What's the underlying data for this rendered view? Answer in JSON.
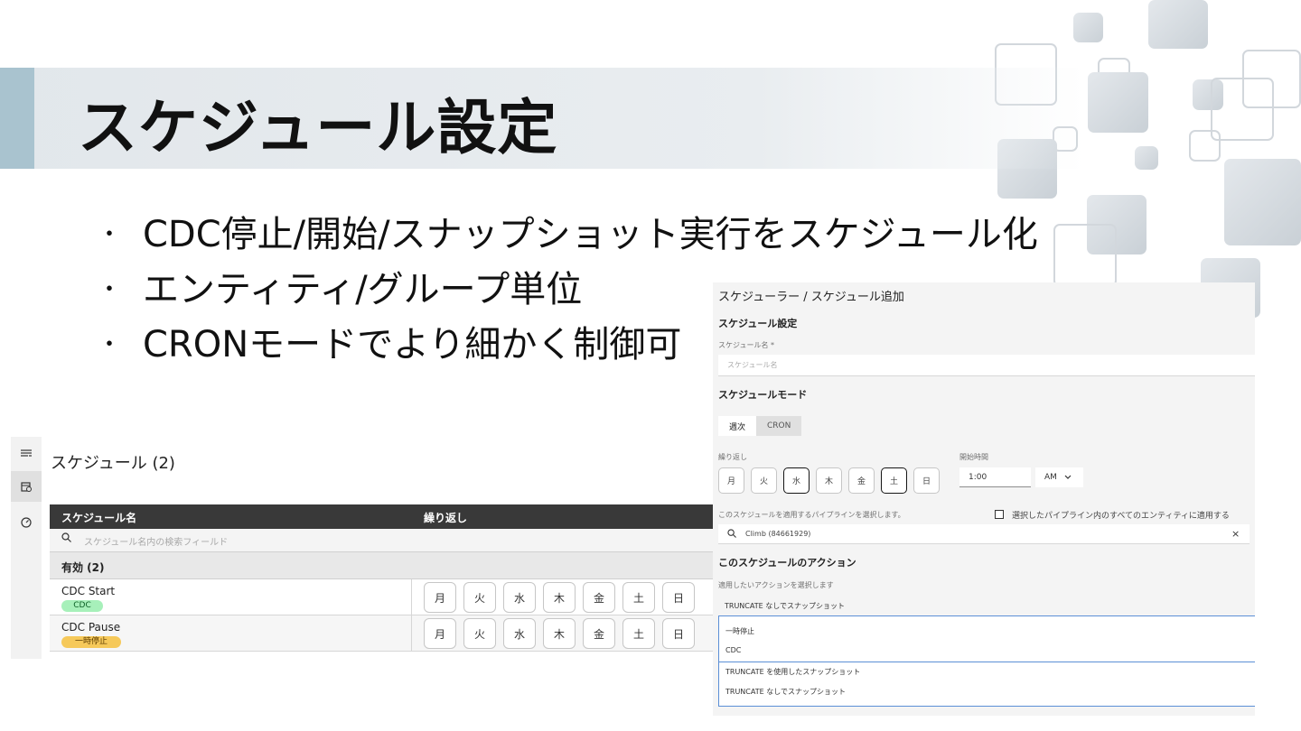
{
  "slide": {
    "title": "スケジュール設定",
    "bullet_marker": "・",
    "bullets": [
      "CDC停止/開始/スナップショット実行をスケジュール化",
      "エンティティ/グループ単位",
      "CRONモードでより細かく制御可"
    ]
  },
  "schedule_list": {
    "rail_icons": [
      "list-icon",
      "calendar-icon",
      "dashboard-icon"
    ],
    "title": "スケジュール (2)",
    "columns": [
      "スケジュール名",
      "繰り返し"
    ],
    "search_placeholder": "スケジュール名内の検索フィールド",
    "group_label": "有効 (2)",
    "days": [
      "月",
      "火",
      "水",
      "木",
      "金",
      "土",
      "日"
    ],
    "rows": [
      {
        "name": "CDC Start",
        "badge": "CDC",
        "badge_color": "#a7f0ba"
      },
      {
        "name": "CDC Pause",
        "badge": "一時停止",
        "badge_color": "#f6c95a"
      }
    ]
  },
  "add_form": {
    "breadcrumb": "スケジューラー / スケジュール追加",
    "section_settings": "スケジュール設定",
    "name_label": "スケジュール名 *",
    "name_placeholder": "スケジュール名",
    "section_mode": "スケジュールモード",
    "tabs": [
      "週次",
      "CRON"
    ],
    "active_tab": "週次",
    "repeat_label": "繰り返し",
    "days": [
      "月",
      "火",
      "水",
      "木",
      "金",
      "土",
      "日"
    ],
    "selected_days": [
      "水",
      "土"
    ],
    "start_time_label": "開始時間",
    "start_time_value": "1:00",
    "ampm_value": "AM",
    "pipeline_label": "このスケジュールを適用するパイプラインを選択します。",
    "apply_all_label": "選択したパイプライン内のすべてのエンティティに適用する",
    "pipeline_value": "Climb (84661929)",
    "section_actions": "このスケジュールのアクション",
    "action_label": "適用したいアクションを選択します",
    "action_value": "TRUNCATE なしでスナップショット",
    "action_options": [
      "一時停止",
      "CDC",
      "TRUNCATE を使用したスナップショット",
      "TRUNCATE なしでスナップショット"
    ]
  }
}
